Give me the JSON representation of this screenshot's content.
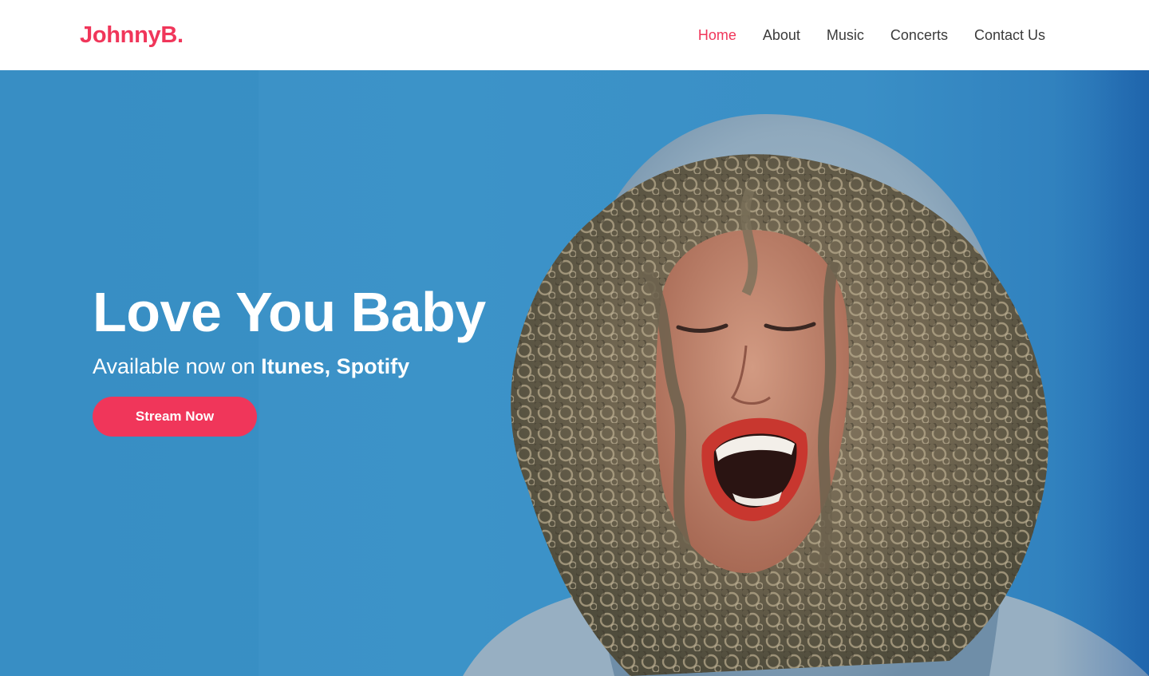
{
  "header": {
    "logo": "JohnnyB.",
    "nav": [
      {
        "label": "Home",
        "active": true
      },
      {
        "label": "About",
        "active": false
      },
      {
        "label": "Music",
        "active": false
      },
      {
        "label": "Concerts",
        "active": false
      },
      {
        "label": "Contact Us",
        "active": false
      }
    ]
  },
  "hero": {
    "title": "Love You Baby",
    "subtitle_prefix": "Available now on ",
    "subtitle_platforms": "Itunes, Spotify",
    "cta_label": "Stream Now",
    "image": "photo of a laughing person with curly hair in a grey hoodie against a blue wall"
  },
  "colors": {
    "accent": "#f0365a",
    "hero_background": "#3b91c6",
    "nav_text": "#3b3b3b",
    "header_background": "#ffffff"
  }
}
